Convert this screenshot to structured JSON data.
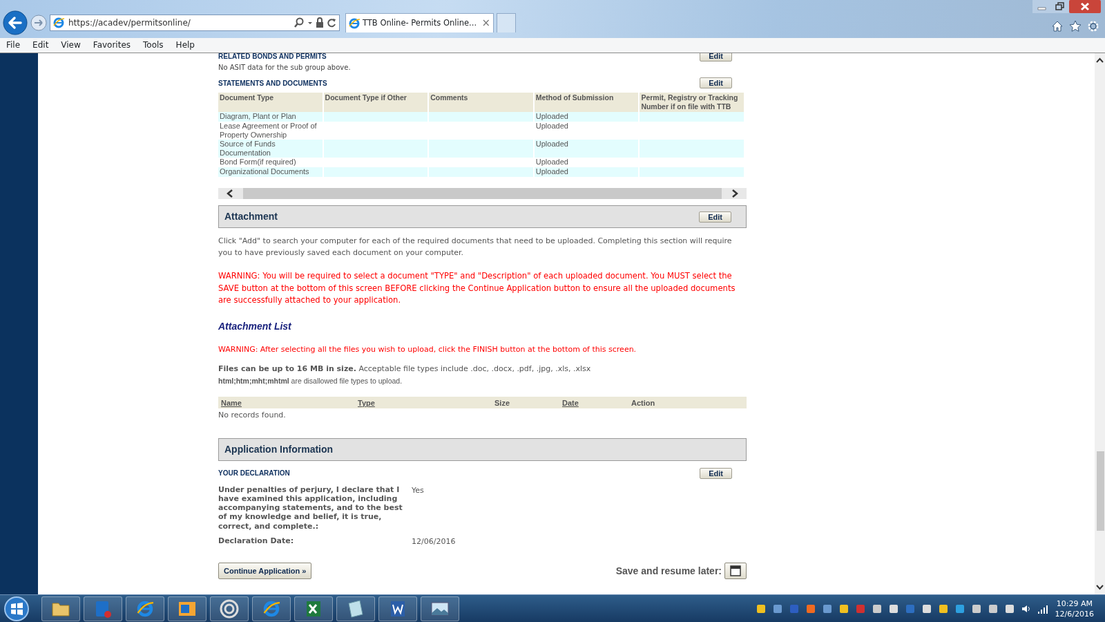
{
  "browser": {
    "address": "https://acadev/permitsonline/",
    "tab": {
      "title": "TTB Online- Permits Online...",
      "close": "×"
    },
    "menu": [
      "File",
      "Edit",
      "View",
      "Favorites",
      "Tools",
      "Help"
    ]
  },
  "related": {
    "title": "RELATED BONDS AND PERMITS",
    "edit": "Edit",
    "note": "No ASIT data for the sub group above."
  },
  "statements": {
    "title": "STATEMENTS AND DOCUMENTS",
    "edit": "Edit",
    "columns": [
      "Document Type",
      "Document Type if Other",
      "Comments",
      "Method of Submission",
      "Permit, Registry or Tracking Number if on file with TTB"
    ],
    "rows": [
      [
        "Diagram, Plant or Plan",
        "",
        "",
        "Uploaded",
        ""
      ],
      [
        "Lease Agreement or Proof of Property Ownership",
        "",
        "",
        "Uploaded",
        ""
      ],
      [
        "Source of Funds Documentation",
        "",
        "",
        "Uploaded",
        ""
      ],
      [
        "Bond Form(if required)",
        "",
        "",
        "Uploaded",
        ""
      ],
      [
        "Organizational Documents",
        "",
        "",
        "Uploaded",
        ""
      ]
    ]
  },
  "attachment": {
    "title": "Attachment",
    "edit": "Edit",
    "instructions": "Click \"Add\" to search your computer for each of the required documents that need to be uploaded.  Completing this section will require you to have previously saved each document on your computer.",
    "warning": "WARNING: You will be required to select a document \"TYPE\" and \"Description\" of each uploaded document. You MUST select the SAVE button at the bottom of this screen BEFORE clicking the Continue Application button to ensure all the uploaded documents are successfully attached to your application.",
    "list_title": "Attachment List",
    "list_warning": "WARNING: After selecting all the files you wish to upload, click the FINISH button at the bottom of this screen.",
    "limits": "**Files can be up to 16 MB in size.** Acceptable file types include .doc, .docx, .pdf, .jpg, .xls, .xlsx",
    "disallowed": "**html;htm;mht;mhtml** are disallowed file types to upload.",
    "columns": [
      {
        "label": "Name",
        "sortable": true
      },
      {
        "label": "Type",
        "sortable": true
      },
      {
        "label": "Size",
        "sortable": false
      },
      {
        "label": "Date",
        "sortable": true
      },
      {
        "label": "Action",
        "sortable": false
      }
    ],
    "empty": "No records found."
  },
  "application": {
    "title": "Application Information",
    "subtitle": "YOUR DECLARATION",
    "edit": "Edit",
    "fields": [
      {
        "label": "Under penalties of perjury, I declare that I have examined this application, including accompanying statements, and to the best of my knowledge and belief, it is true, correct, and complete.:",
        "value": "Yes"
      },
      {
        "label": "Declaration Date:",
        "value": "12/06/2016"
      }
    ]
  },
  "actions": {
    "continue": "Continue Application »",
    "save_label": "Save and resume later:"
  },
  "taskbar": {
    "time": "10:29 AM",
    "date": "12/6/2016"
  }
}
